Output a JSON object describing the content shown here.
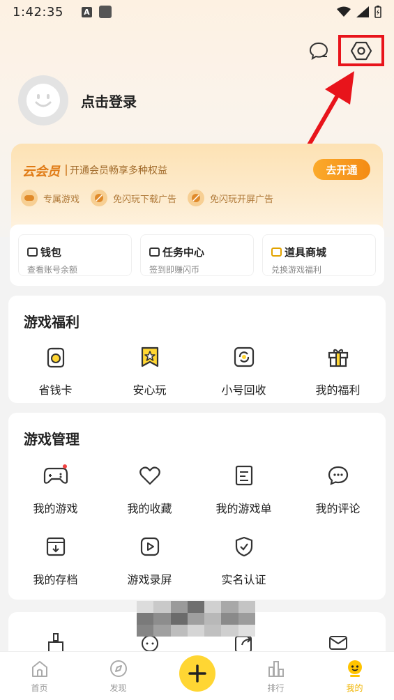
{
  "status_bar": {
    "time": "1:42:35",
    "a_badge": "A"
  },
  "profile": {
    "login_label": "点击登录"
  },
  "vip": {
    "title": "云会员",
    "desc": "开通会员畅享多种权益",
    "button": "去开通",
    "perks": [
      "专属游戏",
      "免闪玩下载广告",
      "免闪玩开屏广告"
    ]
  },
  "wallet": [
    {
      "title": "钱包",
      "sub": "查看账号余额"
    },
    {
      "title": "任务中心",
      "sub": "签到即赚闪币"
    },
    {
      "title": "道具商城",
      "sub": "兑换游戏福利"
    }
  ],
  "welfare": {
    "title": "游戏福利",
    "items": [
      "省钱卡",
      "安心玩",
      "小号回收",
      "我的福利"
    ]
  },
  "manage": {
    "title": "游戏管理",
    "row1": [
      "我的游戏",
      "我的收藏",
      "我的游戏单",
      "我的评论"
    ],
    "row2": [
      "我的存档",
      "游戏录屏",
      "实名认证"
    ]
  },
  "nav": {
    "home": "首页",
    "discover": "发现",
    "rank": "排行",
    "mine": "我的"
  },
  "colors": {
    "accent": "#ffd633",
    "vip_orange": "#f48b14",
    "highlight_red": "#e8141b"
  }
}
